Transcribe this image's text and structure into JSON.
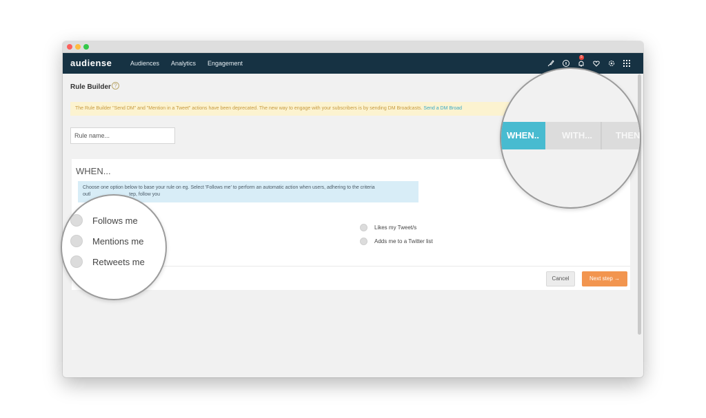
{
  "window": {
    "nav": {
      "logo": "audiense",
      "links": [
        "Audiences",
        "Analytics",
        "Engagement"
      ],
      "notification_count": "5",
      "icons": [
        "rocket-icon",
        "help-icon",
        "bell-icon",
        "heart-icon",
        "gear-icon",
        "apps-grid-icon"
      ]
    },
    "page": {
      "title": "Rule Builder",
      "help": "?",
      "notice_text": "The Rule Builder \"Send DM\" and \"Mention in a Tweet\" actions have been deprecated. The new way to engage with your subscribers is by sending DM Broadcasts. ",
      "notice_link": "Send a DM Broad",
      "rule_name_placeholder": "Rule name..."
    },
    "steps": [
      "WHEN...",
      "WITH...",
      "THEN..."
    ],
    "when": {
      "heading": "WHEN...",
      "info_line1": "Choose one option below to base your rule on eg. Select 'Follows me' to perform an automatic action when users, adhering to the criteria",
      "info_line2": "outl",
      "info_line2_end": "tep, follow you",
      "options_left": [
        "Follows me",
        "Mentions me",
        "Retweets me"
      ],
      "options_right": [
        "Likes my Tweet/s",
        "Adds me to a Twitter list"
      ]
    },
    "buttons": {
      "cancel": "Cancel",
      "next": "Next step →"
    }
  }
}
